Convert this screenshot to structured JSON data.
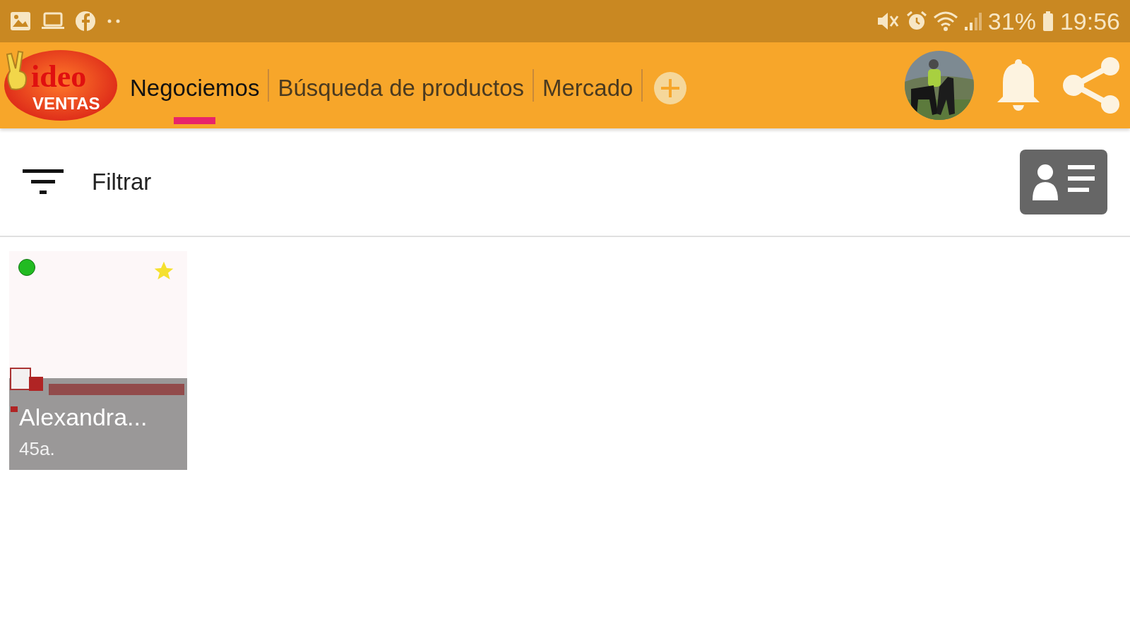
{
  "status_bar": {
    "battery": "31%",
    "time": "19:56"
  },
  "logo": {
    "word": "ideo",
    "tagline": "VENTAS"
  },
  "tabs": [
    {
      "label": "Negociemos",
      "selected": true
    },
    {
      "label": "Búsqueda de productos",
      "selected": false
    },
    {
      "label": "Mercado",
      "selected": false
    }
  ],
  "filter": {
    "label": "Filtrar"
  },
  "cards": [
    {
      "name": "Alexandra...",
      "age": "45a.",
      "color": "#22bb22",
      "favorite": true,
      "kind": "picture"
    }
  ]
}
